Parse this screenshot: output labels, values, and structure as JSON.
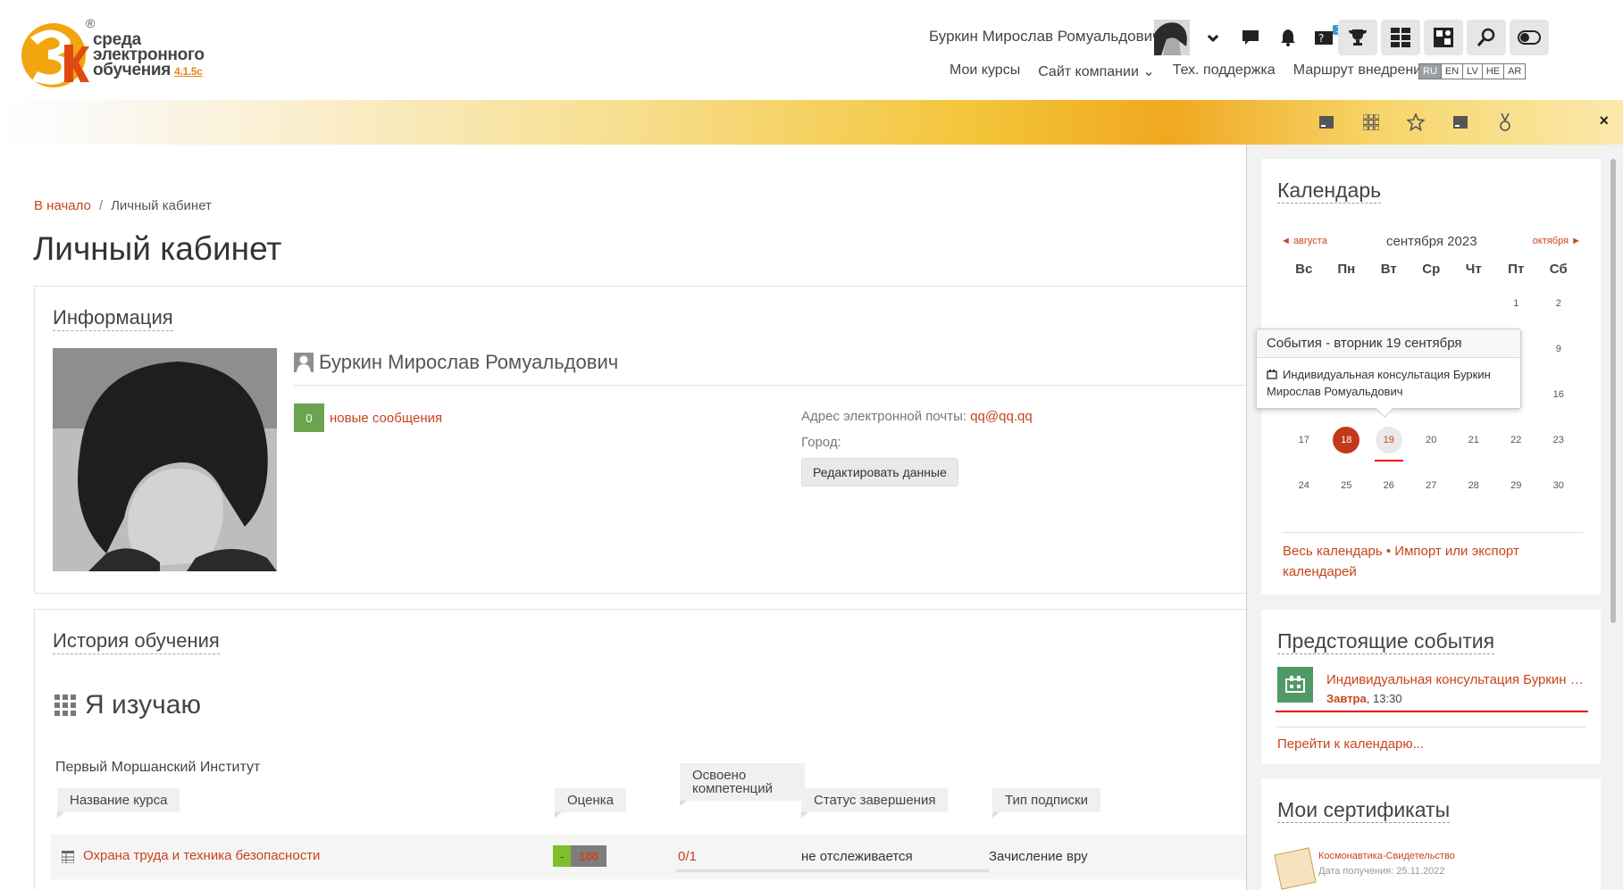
{
  "logo": {
    "line1": "среда",
    "line2": "электронного",
    "line3": "обучения",
    "version": "4.1.5c",
    "reg": "®"
  },
  "user": {
    "name": "Буркин Мирослав Ромуальдович"
  },
  "header_icons": {
    "chevron": "⌄",
    "messages": "💬",
    "notifications": "🔔",
    "help": "?",
    "help_badge": "1",
    "trophy": "🏆",
    "grid": "▦",
    "cube": "▣",
    "search": "🔍",
    "toggle": "◐"
  },
  "nav": {
    "items": [
      "Мои курсы",
      "Сайт компании ⌄",
      "Тех. поддержка",
      "Маршрут внедрения"
    ]
  },
  "langs": [
    "RU",
    "EN",
    "LV",
    "HE",
    "AR"
  ],
  "banner": {
    "close": "×"
  },
  "breadcrumb": {
    "home": "В начало",
    "sep": "/",
    "current": "Личный кабинет"
  },
  "page_title": "Личный кабинет",
  "info": {
    "title": "Информация",
    "name": "Буркин Мирослав Ромуальдович",
    "msg_count": "0",
    "msg_link": "новые сообщения",
    "email_label": "Адрес электронной почты: ",
    "email_value": "qq@qq.qq",
    "city_label": "Город:",
    "edit_button": "Редактировать данные"
  },
  "history": {
    "title": "История обучения",
    "study_heading": "Я изучаю",
    "institute": "Первый Моршанский Институт",
    "columns": [
      "Название курса",
      "Оценка",
      "Освоено компетенций",
      "Статус завершения",
      "Тип подписки"
    ],
    "course": {
      "name": "Охрана труда и техника безопасности",
      "grade_prefix": "-",
      "grade": "100",
      "competencies": "0/1",
      "status": "не отслеживается",
      "subscription": "Зачисление вру"
    }
  },
  "calendar": {
    "title": "Календарь",
    "prev": "◄  августа",
    "next": "октября  ►",
    "month": "сентября 2023",
    "weekdays": [
      "Вс",
      "Пн",
      "Вт",
      "Ср",
      "Чт",
      "Пт",
      "Сб"
    ],
    "week1": [
      "",
      "",
      "",
      "",
      "",
      "1",
      "2"
    ],
    "week2": [
      "",
      "",
      "",
      "",
      "",
      "",
      "9"
    ],
    "week3": [
      "",
      "",
      "",
      "",
      "",
      "",
      "16"
    ],
    "week4": [
      "17",
      "18",
      "19",
      "20",
      "21",
      "22",
      "23"
    ],
    "week5": [
      "24",
      "25",
      "26",
      "27",
      "28",
      "29",
      "30"
    ],
    "link_full": "Весь календарь",
    "link_sep": " • ",
    "link_import": "Импорт или экспорт календарей"
  },
  "popover": {
    "title": "События - вторник 19 сентября",
    "event": "Индивидуальная консультация Буркин Мирослав Ромуальдович"
  },
  "upcoming": {
    "title": "Предстоящие события",
    "event_name": "Индивидуальная консультация Буркин Мирослав Ромуальдович",
    "event_day": "Завтра",
    "event_time": ", 13:30",
    "goto": "Перейти к календарю..."
  },
  "certificates": {
    "title": "Мои сертификаты",
    "name": "Космонавтика-Свидетельство",
    "date": "Дата получения: 25.11.2022"
  }
}
